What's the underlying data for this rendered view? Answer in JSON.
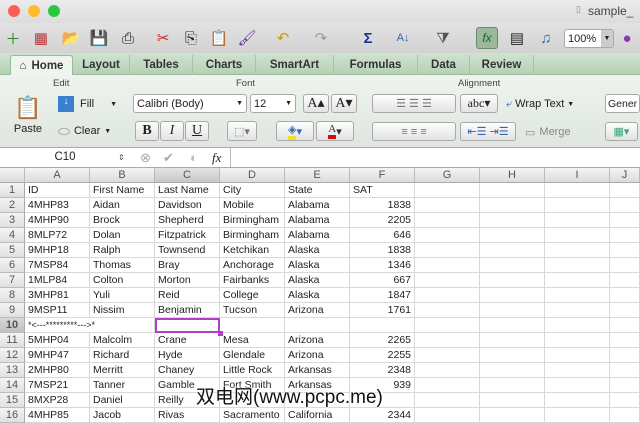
{
  "window": {
    "title": "sample_"
  },
  "toolbar": {
    "zoom": "100%"
  },
  "tabs": [
    "Home",
    "Layout",
    "Tables",
    "Charts",
    "SmartArt",
    "Formulas",
    "Data",
    "Review"
  ],
  "ribbon": {
    "edit_label": "Edit",
    "font_label": "Font",
    "alignment_label": "Alignment",
    "paste": "Paste",
    "fill": "Fill",
    "clear": "Clear",
    "font_name": "Calibri (Body)",
    "font_size": "12",
    "bold": "B",
    "italic": "I",
    "underline": "U",
    "abc": "abc",
    "wrap_text": "Wrap Text",
    "merge": "Merge",
    "number_format": "Gener"
  },
  "formula_bar": {
    "name_box": "C10",
    "fx": "fx",
    "value": ""
  },
  "columns": [
    "A",
    "B",
    "C",
    "D",
    "E",
    "F",
    "G",
    "H",
    "I",
    "J"
  ],
  "rows": [
    [
      "ID",
      "First Name",
      "Last Name",
      "City",
      "State",
      "SAT"
    ],
    [
      "4MHP83",
      "Aidan",
      "Davidson",
      "Mobile",
      "Alabama",
      "1838"
    ],
    [
      "4MHP90",
      " Brock",
      "Shepherd",
      "Birmingham",
      "Alabama",
      "2205"
    ],
    [
      "8MLP72",
      "Dolan",
      "Fitzpatrick",
      "Birmingham",
      "Alabama",
      "646"
    ],
    [
      "9MHP18",
      "Ralph",
      "Townsend",
      "Ketchikan",
      "Alaska",
      "1838"
    ],
    [
      "7MSP84",
      "Thomas",
      "Bray",
      "Anchorage",
      "Alaska",
      "1346"
    ],
    [
      "1MLP84",
      "Colton",
      "Morton",
      "Fairbanks",
      "Alaska",
      "667"
    ],
    [
      "3MHP81",
      "Yuli",
      "Reid",
      "College",
      "Alaska",
      "1847"
    ],
    [
      "9MSP11",
      "Nissim",
      "Benjamin",
      "Tucson",
      "Arizona",
      "1761"
    ],
    [
      "*<---*********--->*",
      "",
      "",
      "",
      "",
      ""
    ],
    [
      "5MHP04",
      "Malcolm",
      "Crane",
      "Mesa",
      "Arizona",
      "2265"
    ],
    [
      "9MHP47",
      "Richard",
      "Hyde",
      "Glendale",
      "Arizona",
      "2255"
    ],
    [
      "2MHP80",
      "Merritt",
      "Chaney",
      "Little Rock",
      "Arkansas",
      "2348"
    ],
    [
      "7MSP21",
      "Tanner",
      "Gamble",
      "Fort Smith",
      "Arkansas",
      "939"
    ],
    [
      "8MXP28",
      "Daniel",
      "Reilly",
      "",
      "",
      ""
    ],
    [
      "4MHP85",
      "Jacob",
      "Rivas",
      "Sacramento",
      "California",
      "2344"
    ]
  ],
  "watermark": "双电网(www.pcpc.me)",
  "colors": {
    "selection": "#b23fc9",
    "ribbon_tab": "#b5d1b5"
  }
}
